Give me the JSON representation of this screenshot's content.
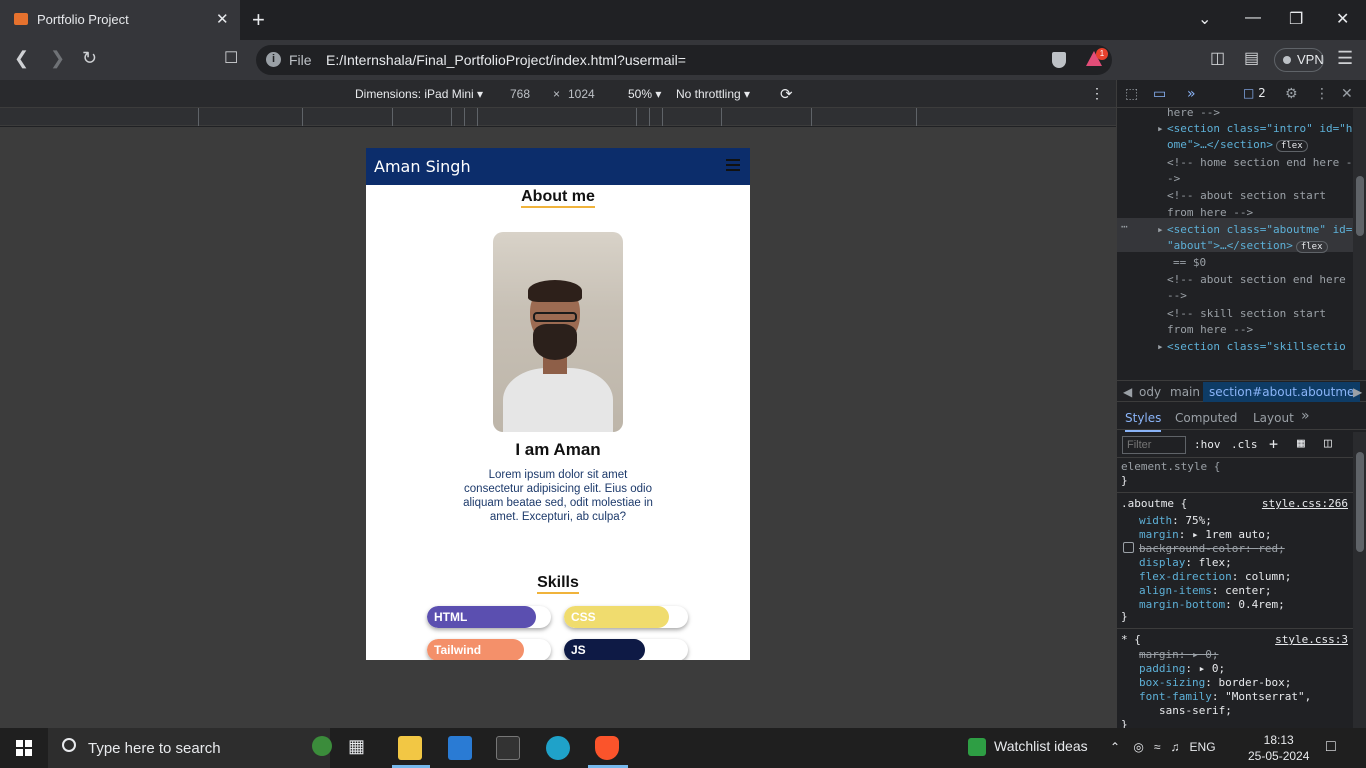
{
  "browser": {
    "tab_title": "Portfolio Project",
    "tab_close": "✕",
    "new_tab": "+",
    "minimize": "⌄",
    "restore": "—",
    "maximize": "❐",
    "close": "✕",
    "scheme_label": "File",
    "url": "E:/Internshala/Final_PortfolioProject/index.html?usermail=",
    "rewards_badge": "1",
    "vpn_label": "VPN"
  },
  "device_toolbar": {
    "device": "Dimensions: iPad Mini",
    "width": "768",
    "times": "×",
    "height": "1024",
    "zoom": "50%",
    "throttle": "No throttling"
  },
  "page": {
    "brand": "Aman Singh",
    "about_title": "About me",
    "intro_heading": "I am Aman",
    "intro_text": "Lorem ipsum dolor sit amet consectetur adipisicing elit. Eius odio aliquam beatae sed, odit molestiae in amet. Excepturi, ab culpa?",
    "skills_title": "Skills",
    "skills": [
      {
        "label": "HTML",
        "level": 0.88,
        "color": "#5b4fb0"
      },
      {
        "label": "CSS",
        "level": 0.85,
        "color": "#f0dc6e"
      },
      {
        "label": "Tailwind",
        "level": 0.78,
        "color": "#f4906a"
      },
      {
        "label": "JS",
        "level": 0.65,
        "color": "#0e1a45"
      }
    ]
  },
  "devtools": {
    "issues_count": "2",
    "elements": [
      {
        "text": "here -->",
        "kind": "cmt"
      },
      {
        "text": "<section class=\"intro\" id=\"h",
        "kind": "tag"
      },
      {
        "text": "ome\">…</section>",
        "kind": "tag",
        "pill": "flex"
      },
      {
        "text": "<!-- home section end here -",
        "kind": "cmt"
      },
      {
        "text": "->",
        "kind": "cmt"
      },
      {
        "text": "<!-- about section start",
        "kind": "cmt"
      },
      {
        "text": "from here -->",
        "kind": "cmt"
      },
      {
        "text": "<section class=\"aboutme\" id=",
        "kind": "tag"
      },
      {
        "text": "\"about\">…</section>",
        "kind": "tag",
        "pill": "flex"
      },
      {
        "text": "== $0",
        "kind": "cmt"
      },
      {
        "text": "<!-- about section end here",
        "kind": "cmt"
      },
      {
        "text": "-->",
        "kind": "cmt"
      },
      {
        "text": "<!-- skill section start",
        "kind": "cmt"
      },
      {
        "text": "from here -->",
        "kind": "cmt"
      },
      {
        "text": "<section class=\"skillsectio",
        "kind": "tag"
      }
    ],
    "crumbs": [
      "ody",
      "main",
      "section#about.aboutme"
    ],
    "tabs": [
      "Styles",
      "Computed",
      "Layout"
    ],
    "filter_placeholder": "Filter",
    "hov": ":hov",
    "cls": ".cls",
    "element_style": "element.style {",
    "rule1_selector": ".aboutme {",
    "rule1_source": "style.css:266",
    "rule1_props": [
      {
        "prop": "width",
        "value": "75%;"
      },
      {
        "prop": "margin",
        "value": "▸ 1rem auto;"
      },
      {
        "prop": "background-color",
        "value": "red;",
        "struck": true
      },
      {
        "prop": "display",
        "value": "flex;"
      },
      {
        "prop": "flex-direction",
        "value": "column;"
      },
      {
        "prop": "align-items",
        "value": "center;"
      },
      {
        "prop": "margin-bottom",
        "value": "0.4rem;"
      }
    ],
    "rule2_selector": "* {",
    "rule2_source": "style.css:3",
    "rule2_props": [
      {
        "prop": "margin",
        "value": "▸ 0;",
        "struck": true
      },
      {
        "prop": "padding",
        "value": "▸ 0;"
      },
      {
        "prop": "box-sizing",
        "value": "border-box;"
      },
      {
        "prop": "font-family",
        "value": "\"Montserrat\","
      }
    ],
    "rule2_cont": "sans-serif;"
  },
  "taskbar": {
    "search_placeholder": "Type here to search",
    "watchlist": "Watchlist ideas",
    "lang": "ENG",
    "time": "18:13",
    "date": "25-05-2024"
  }
}
